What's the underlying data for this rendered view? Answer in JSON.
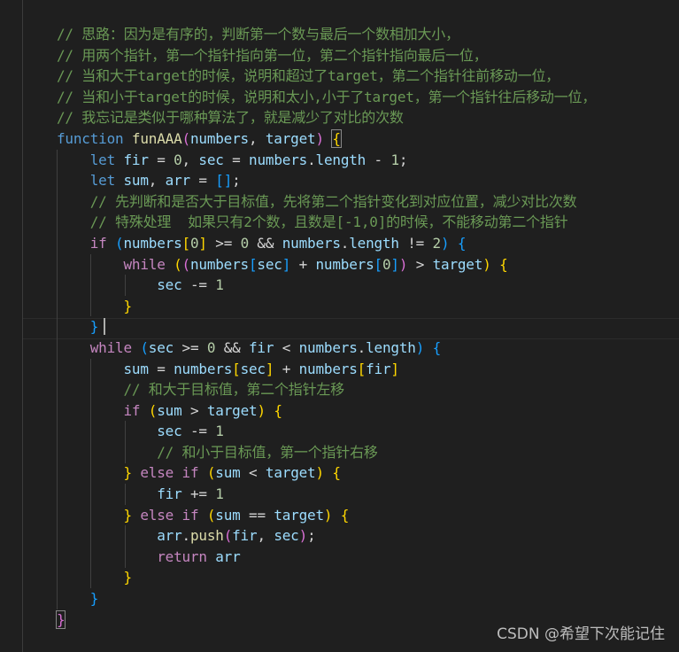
{
  "editor": {
    "language": "javascript",
    "lines": [
      {
        "tokens": [
          {
            "t": "// 思路：因为是有序的，判断第一个数与最后一个数相加大小，",
            "c": "cmt"
          }
        ]
      },
      {
        "tokens": [
          {
            "t": "// 用两个指针，第一个指针指向第一位，第二个指针指向最后一位，",
            "c": "cmt"
          }
        ]
      },
      {
        "tokens": [
          {
            "t": "// 当和大于target的时候，说明和超过了target，第二个指针往前移动一位，",
            "c": "cmt"
          }
        ]
      },
      {
        "tokens": [
          {
            "t": "// 当和小于target的时候，说明和太小,小于了target，第一个指针往后移动一位，",
            "c": "cmt"
          }
        ]
      },
      {
        "tokens": [
          {
            "t": "// 我忘记是类似于哪种算法了，就是减少了对比的次数",
            "c": "cmt"
          }
        ]
      },
      {
        "tokens": [
          {
            "t": "function",
            "c": "kw"
          },
          {
            "t": " ",
            "c": "op"
          },
          {
            "t": "funAAA",
            "c": "fn"
          },
          {
            "t": "(",
            "c": "b2"
          },
          {
            "t": "numbers",
            "c": "var"
          },
          {
            "t": ", ",
            "c": "op"
          },
          {
            "t": "target",
            "c": "var"
          },
          {
            "t": ")",
            "c": "b2"
          },
          {
            "t": " ",
            "c": "op"
          },
          {
            "t": "{",
            "c": "b1",
            "match": true
          }
        ]
      },
      {
        "indent": 1,
        "tokens": [
          {
            "t": "let",
            "c": "kw"
          },
          {
            "t": " ",
            "c": "op"
          },
          {
            "t": "fir",
            "c": "var"
          },
          {
            "t": " = ",
            "c": "op"
          },
          {
            "t": "0",
            "c": "num"
          },
          {
            "t": ", ",
            "c": "op"
          },
          {
            "t": "sec",
            "c": "var"
          },
          {
            "t": " = ",
            "c": "op"
          },
          {
            "t": "numbers",
            "c": "var"
          },
          {
            "t": ".",
            "c": "op"
          },
          {
            "t": "length",
            "c": "var"
          },
          {
            "t": " - ",
            "c": "op"
          },
          {
            "t": "1",
            "c": "num"
          },
          {
            "t": ";",
            "c": "op"
          }
        ]
      },
      {
        "indent": 1,
        "tokens": [
          {
            "t": "let",
            "c": "kw"
          },
          {
            "t": " ",
            "c": "op"
          },
          {
            "t": "sum",
            "c": "var"
          },
          {
            "t": ", ",
            "c": "op"
          },
          {
            "t": "arr",
            "c": "var"
          },
          {
            "t": " = ",
            "c": "op"
          },
          {
            "t": "[]",
            "c": "b3"
          },
          {
            "t": ";",
            "c": "op"
          }
        ]
      },
      {
        "indent": 1,
        "tokens": [
          {
            "t": "// 先判断和是否大于目标值，先将第二个指针变化到对应位置，减少对比次数",
            "c": "cmt"
          }
        ]
      },
      {
        "indent": 1,
        "tokens": [
          {
            "t": "// 特殊处理  如果只有2个数，且数是[-1,0]的时候，不能移动第二个指针",
            "c": "cmt"
          }
        ]
      },
      {
        "indent": 1,
        "tokens": [
          {
            "t": "if",
            "c": "ctl"
          },
          {
            "t": " ",
            "c": "op"
          },
          {
            "t": "(",
            "c": "b3"
          },
          {
            "t": "numbers",
            "c": "var"
          },
          {
            "t": "[",
            "c": "b1"
          },
          {
            "t": "0",
            "c": "num"
          },
          {
            "t": "]",
            "c": "b1"
          },
          {
            "t": " >= ",
            "c": "op"
          },
          {
            "t": "0",
            "c": "num"
          },
          {
            "t": " && ",
            "c": "op"
          },
          {
            "t": "numbers",
            "c": "var"
          },
          {
            "t": ".",
            "c": "op"
          },
          {
            "t": "length",
            "c": "var"
          },
          {
            "t": " != ",
            "c": "op"
          },
          {
            "t": "2",
            "c": "num"
          },
          {
            "t": ")",
            "c": "b3"
          },
          {
            "t": " ",
            "c": "op"
          },
          {
            "t": "{",
            "c": "b3"
          }
        ]
      },
      {
        "indent": 2,
        "tokens": [
          {
            "t": "while",
            "c": "ctl"
          },
          {
            "t": " ",
            "c": "op"
          },
          {
            "t": "(",
            "c": "b1"
          },
          {
            "t": "(",
            "c": "b2"
          },
          {
            "t": "numbers",
            "c": "var"
          },
          {
            "t": "[",
            "c": "b3"
          },
          {
            "t": "sec",
            "c": "var"
          },
          {
            "t": "]",
            "c": "b3"
          },
          {
            "t": " + ",
            "c": "op"
          },
          {
            "t": "numbers",
            "c": "var"
          },
          {
            "t": "[",
            "c": "b3"
          },
          {
            "t": "0",
            "c": "num"
          },
          {
            "t": "]",
            "c": "b3"
          },
          {
            "t": ")",
            "c": "b2"
          },
          {
            "t": " > ",
            "c": "op"
          },
          {
            "t": "target",
            "c": "var"
          },
          {
            "t": ")",
            "c": "b1"
          },
          {
            "t": " ",
            "c": "op"
          },
          {
            "t": "{",
            "c": "b1"
          }
        ]
      },
      {
        "indent": 3,
        "tokens": [
          {
            "t": "sec",
            "c": "var"
          },
          {
            "t": " -= ",
            "c": "op"
          },
          {
            "t": "1",
            "c": "num"
          }
        ]
      },
      {
        "indent": 2,
        "tokens": [
          {
            "t": "}",
            "c": "b1"
          }
        ]
      },
      {
        "indent": 1,
        "current": true,
        "tokens": [
          {
            "t": "}",
            "c": "b3"
          }
        ]
      },
      {
        "indent": 1,
        "tokens": [
          {
            "t": "while",
            "c": "ctl"
          },
          {
            "t": " ",
            "c": "op"
          },
          {
            "t": "(",
            "c": "b3"
          },
          {
            "t": "sec",
            "c": "var"
          },
          {
            "t": " >= ",
            "c": "op"
          },
          {
            "t": "0",
            "c": "num"
          },
          {
            "t": " && ",
            "c": "op"
          },
          {
            "t": "fir",
            "c": "var"
          },
          {
            "t": " < ",
            "c": "op"
          },
          {
            "t": "numbers",
            "c": "var"
          },
          {
            "t": ".",
            "c": "op"
          },
          {
            "t": "length",
            "c": "var"
          },
          {
            "t": ")",
            "c": "b3"
          },
          {
            "t": " ",
            "c": "op"
          },
          {
            "t": "{",
            "c": "b3"
          }
        ]
      },
      {
        "indent": 2,
        "tokens": [
          {
            "t": "sum",
            "c": "var"
          },
          {
            "t": " = ",
            "c": "op"
          },
          {
            "t": "numbers",
            "c": "var"
          },
          {
            "t": "[",
            "c": "b1"
          },
          {
            "t": "sec",
            "c": "var"
          },
          {
            "t": "]",
            "c": "b1"
          },
          {
            "t": " + ",
            "c": "op"
          },
          {
            "t": "numbers",
            "c": "var"
          },
          {
            "t": "[",
            "c": "b1"
          },
          {
            "t": "fir",
            "c": "var"
          },
          {
            "t": "]",
            "c": "b1"
          }
        ]
      },
      {
        "indent": 2,
        "tokens": [
          {
            "t": "// 和大于目标值，第二个指针左移",
            "c": "cmt"
          }
        ]
      },
      {
        "indent": 2,
        "tokens": [
          {
            "t": "if",
            "c": "ctl"
          },
          {
            "t": " ",
            "c": "op"
          },
          {
            "t": "(",
            "c": "b1"
          },
          {
            "t": "sum",
            "c": "var"
          },
          {
            "t": " > ",
            "c": "op"
          },
          {
            "t": "target",
            "c": "var"
          },
          {
            "t": ")",
            "c": "b1"
          },
          {
            "t": " ",
            "c": "op"
          },
          {
            "t": "{",
            "c": "b1"
          }
        ]
      },
      {
        "indent": 3,
        "tokens": [
          {
            "t": "sec",
            "c": "var"
          },
          {
            "t": " -= ",
            "c": "op"
          },
          {
            "t": "1",
            "c": "num"
          }
        ]
      },
      {
        "indent": 3,
        "tokens": [
          {
            "t": "// 和小于目标值，第一个指针右移",
            "c": "cmt"
          }
        ]
      },
      {
        "indent": 2,
        "tokens": [
          {
            "t": "}",
            "c": "b1"
          },
          {
            "t": " ",
            "c": "op"
          },
          {
            "t": "else",
            "c": "ctl"
          },
          {
            "t": " ",
            "c": "op"
          },
          {
            "t": "if",
            "c": "ctl"
          },
          {
            "t": " ",
            "c": "op"
          },
          {
            "t": "(",
            "c": "b1"
          },
          {
            "t": "sum",
            "c": "var"
          },
          {
            "t": " < ",
            "c": "op"
          },
          {
            "t": "target",
            "c": "var"
          },
          {
            "t": ")",
            "c": "b1"
          },
          {
            "t": " ",
            "c": "op"
          },
          {
            "t": "{",
            "c": "b1"
          }
        ]
      },
      {
        "indent": 3,
        "tokens": [
          {
            "t": "fir",
            "c": "var"
          },
          {
            "t": " += ",
            "c": "op"
          },
          {
            "t": "1",
            "c": "num"
          }
        ]
      },
      {
        "indent": 2,
        "tokens": [
          {
            "t": "}",
            "c": "b1"
          },
          {
            "t": " ",
            "c": "op"
          },
          {
            "t": "else",
            "c": "ctl"
          },
          {
            "t": " ",
            "c": "op"
          },
          {
            "t": "if",
            "c": "ctl"
          },
          {
            "t": " ",
            "c": "op"
          },
          {
            "t": "(",
            "c": "b1"
          },
          {
            "t": "sum",
            "c": "var"
          },
          {
            "t": " == ",
            "c": "op"
          },
          {
            "t": "target",
            "c": "var"
          },
          {
            "t": ")",
            "c": "b1"
          },
          {
            "t": " ",
            "c": "op"
          },
          {
            "t": "{",
            "c": "b1"
          }
        ]
      },
      {
        "indent": 3,
        "tokens": [
          {
            "t": "arr",
            "c": "var"
          },
          {
            "t": ".",
            "c": "op"
          },
          {
            "t": "push",
            "c": "fn"
          },
          {
            "t": "(",
            "c": "b2"
          },
          {
            "t": "fir",
            "c": "var"
          },
          {
            "t": ", ",
            "c": "op"
          },
          {
            "t": "sec",
            "c": "var"
          },
          {
            "t": ")",
            "c": "b2"
          },
          {
            "t": ";",
            "c": "op"
          }
        ]
      },
      {
        "indent": 3,
        "tokens": [
          {
            "t": "return",
            "c": "ctl"
          },
          {
            "t": " ",
            "c": "op"
          },
          {
            "t": "arr",
            "c": "var"
          }
        ]
      },
      {
        "indent": 2,
        "tokens": [
          {
            "t": "}",
            "c": "b1"
          }
        ]
      },
      {
        "indent": 1,
        "tokens": [
          {
            "t": "}",
            "c": "b3"
          }
        ]
      },
      {
        "tokens": [
          {
            "t": "}",
            "c": "b2",
            "match": true
          }
        ]
      }
    ]
  },
  "watermark": "CSDN @希望下次能记住"
}
